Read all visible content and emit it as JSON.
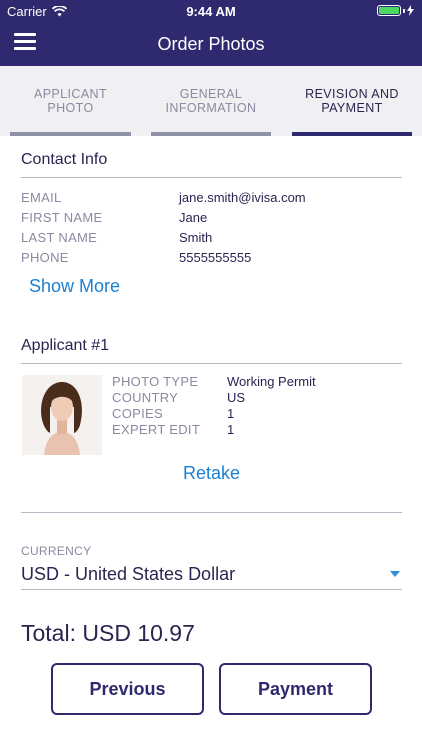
{
  "status_bar": {
    "carrier": "Carrier",
    "time": "9:44 AM",
    "wifi_icon": "wifi-icon",
    "battery_icon": "battery-icon",
    "battery_color": "#4cd964"
  },
  "header": {
    "title": "Order Photos",
    "menu_icon": "hamburger-menu-icon",
    "background": "#2f2a6f"
  },
  "tabs": [
    {
      "label": "APPLICANT PHOTO",
      "active": false
    },
    {
      "label": "GENERAL INFORMATION",
      "active": false
    },
    {
      "label": "REVISION AND PAYMENT",
      "active": true
    }
  ],
  "contact": {
    "title": "Contact Info",
    "fields": [
      {
        "label": "EMAIL",
        "value": "jane.smith@ivisa.com"
      },
      {
        "label": "FIRST NAME",
        "value": "Jane"
      },
      {
        "label": "LAST NAME",
        "value": "Smith"
      },
      {
        "label": "PHONE",
        "value": "5555555555"
      }
    ],
    "show_more": "Show More"
  },
  "applicant": {
    "title": "Applicant #1",
    "fields": [
      {
        "label": "PHOTO TYPE",
        "value": "Working Permit"
      },
      {
        "label": "COUNTRY",
        "value": "US"
      },
      {
        "label": "COPIES",
        "value": "1"
      },
      {
        "label": "EXPERT EDIT",
        "value": "1"
      }
    ],
    "retake": "Retake"
  },
  "currency": {
    "label": "CURRENCY",
    "value": "USD - United States Dollar"
  },
  "total": "Total: USD 10.97",
  "buttons": {
    "previous": "Previous",
    "payment": "Payment"
  },
  "colors": {
    "accent": "#2f2a6f",
    "link": "#1b7fd1",
    "muted": "#8a8aa0"
  }
}
